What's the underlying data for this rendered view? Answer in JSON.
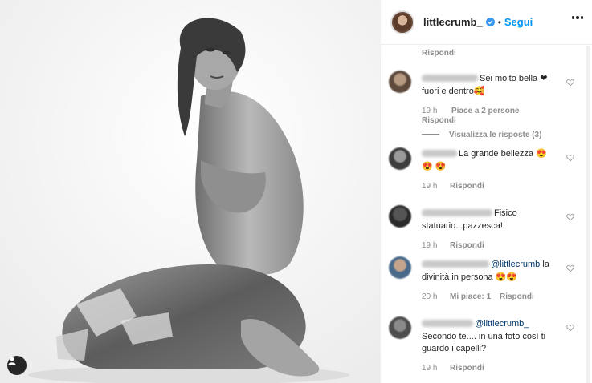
{
  "header": {
    "username": "littlecrumb_",
    "dot": "•",
    "follow_label": "Segui"
  },
  "top_fragment": {
    "reply": "Rispondi"
  },
  "comments": [
    {
      "text": "Sei molto bella ❤fuori e dentro🥰",
      "time": "19 h",
      "likes": "Piace a 2 persone",
      "reply": "Rispondi",
      "view_replies": "Visualizza le risposte (3)"
    },
    {
      "text": "La grande bellezza 😍 😍 😍",
      "time": "19 h",
      "reply": "Rispondi"
    },
    {
      "text": "Fisico statuario...pazzesca!",
      "time": "19 h",
      "reply": "Rispondi"
    },
    {
      "mention": "@littlecrumb",
      "text": " la divinità in persona 😍😍",
      "time": "20 h",
      "likes": "Mi piace: 1",
      "reply": "Rispondi"
    },
    {
      "mention": "@littlecrumb_",
      "text": " Secondo te.... in una foto così ti guardo i capelli?",
      "time": "19 h",
      "reply": "Rispondi"
    }
  ],
  "icons": {
    "verified": "verified-badge-icon",
    "more": "more-options-icon",
    "heart": "heart-icon",
    "user_tag": "user-tag-icon"
  },
  "colors": {
    "accent": "#0095f6",
    "verified": "#3897f0",
    "meta": "#8e8e8e"
  }
}
